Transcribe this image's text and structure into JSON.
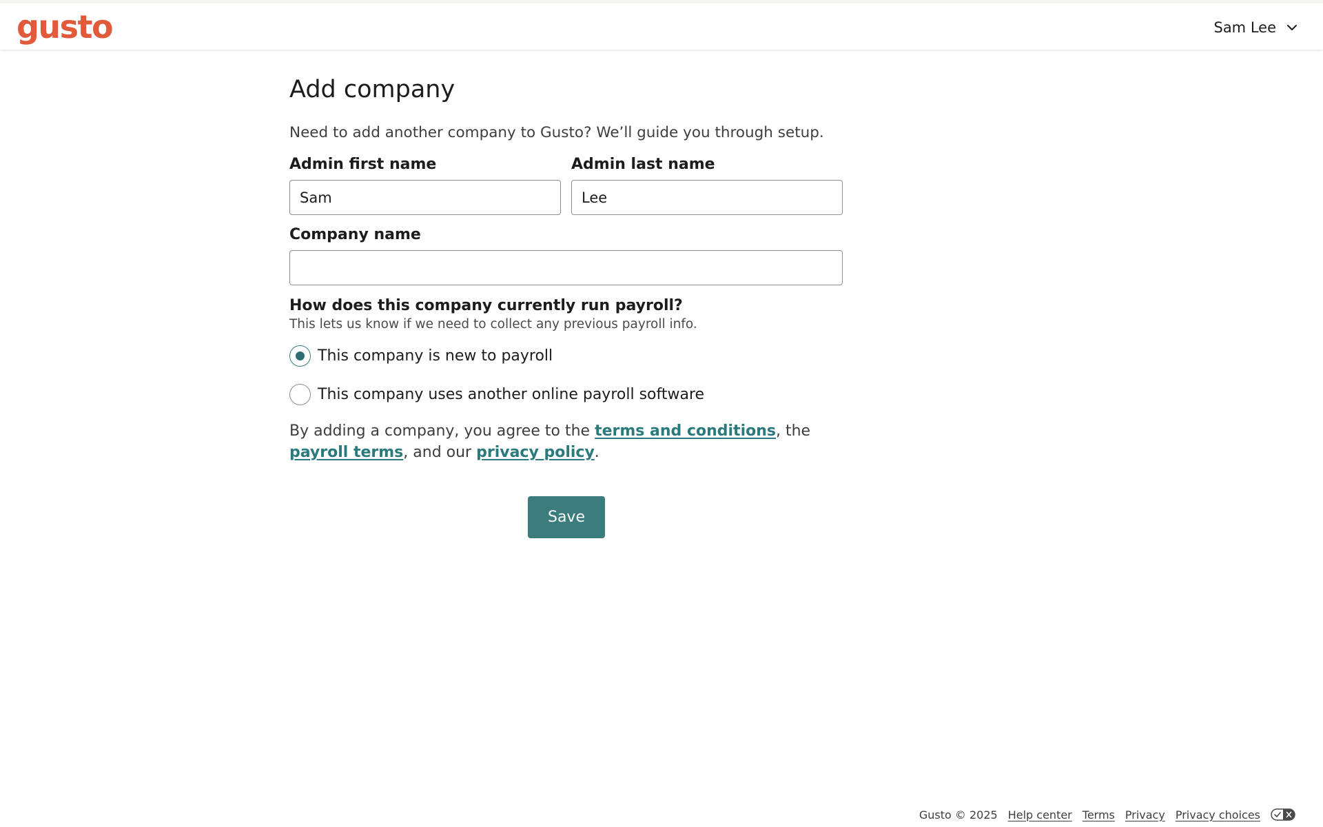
{
  "header": {
    "logo_text": "gusto",
    "user_name": "Sam Lee",
    "brand_color": "#e15a3b"
  },
  "page": {
    "title": "Add company",
    "intro": "Need to add another company to Gusto? We’ll guide you through setup."
  },
  "form": {
    "first_name": {
      "label": "Admin first name",
      "value": "Sam"
    },
    "last_name": {
      "label": "Admin last name",
      "value": "Lee"
    },
    "company_name": {
      "label": "Company name",
      "value": ""
    },
    "payroll_question": {
      "label": "How does this company currently run payroll?",
      "help": "This lets us know if we need to collect any previous payroll info.",
      "options": [
        {
          "label": "This company is new to payroll",
          "selected": true
        },
        {
          "label": "This company uses another online payroll software",
          "selected": false
        }
      ]
    },
    "agreement": {
      "prefix": "By adding a company, you agree to the ",
      "terms_link": "terms and conditions",
      "middle": ", the ",
      "payroll_terms_link": "payroll terms",
      "and_our": ", and our ",
      "privacy_link": "privacy policy",
      "suffix": "."
    },
    "save_label": "Save"
  },
  "footer": {
    "copyright": "Gusto © 2025",
    "links": [
      "Help center",
      "Terms",
      "Privacy",
      "Privacy choices"
    ]
  },
  "colors": {
    "accent": "#3b7c7d",
    "link": "#2a7a7d"
  }
}
